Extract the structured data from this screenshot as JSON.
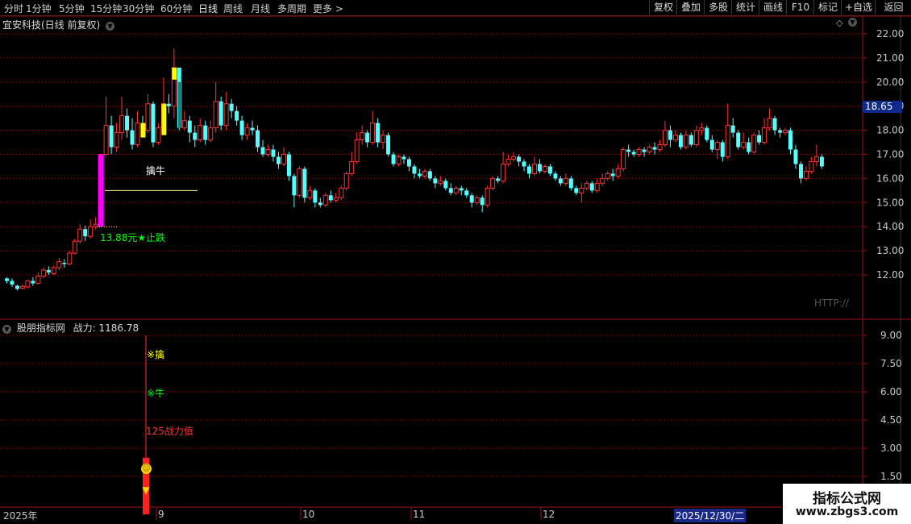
{
  "toolbar": {
    "periods": [
      "分时",
      "1分钟",
      "5分钟",
      "15分钟",
      "30分钟",
      "60分钟",
      "日线",
      "周线",
      "月线",
      "多周期",
      "更多 >"
    ],
    "active_period": "日线",
    "buttons": [
      "复权",
      "叠加",
      "多股",
      "统计",
      "画线",
      "F10",
      "标记",
      "+自选",
      "返回"
    ]
  },
  "main_chart": {
    "title": "宜安科技(日线 前复权)",
    "price_marker": "18.65",
    "watermark_text": "HTTP://",
    "annotations": {
      "niu": "擒牛",
      "stop": "13.88元★止跌"
    }
  },
  "indicator": {
    "title": "股朋指标网",
    "value_label": "战力: 1186.78",
    "labels": {
      "qin": "※擒",
      "niu": "※牛",
      "value": "125战力值"
    }
  },
  "dates": {
    "year": "2025年",
    "m9": "9",
    "m10": "10",
    "m11": "11",
    "m12": "12",
    "cursor": "2025/12/30/二"
  },
  "site_watermark": {
    "line1": "指标公式网",
    "line2": "www.zbgs3.com"
  },
  "colors": {
    "up": "#ff3232",
    "down": "#54ffff",
    "grid": "#a01010",
    "signal_magenta": "#ff00ff",
    "signal_yellow": "#ffff00",
    "signal_green": "#00ff00"
  },
  "chart_data": {
    "type": "candlestick",
    "y_axis": {
      "ticks": [
        "22.00",
        "21.00",
        "20.00",
        "19.00",
        "18.00",
        "17.00",
        "16.00",
        "15.00",
        "14.00",
        "13.00",
        "12.00"
      ],
      "range": [
        11.5,
        22.3
      ]
    },
    "indicator_axis": {
      "ticks": [
        "9.00",
        "7.50",
        "6.00",
        "4.50",
        "3.00",
        "1.50"
      ],
      "range": [
        0,
        10
      ]
    },
    "candles": [
      [
        11.85,
        11.75,
        11.9,
        11.65
      ],
      [
        11.75,
        11.6,
        11.85,
        11.5
      ],
      [
        11.55,
        11.42,
        11.6,
        11.35
      ],
      [
        11.45,
        11.52,
        11.6,
        11.4
      ],
      [
        11.5,
        11.75,
        11.8,
        11.45
      ],
      [
        11.75,
        11.65,
        11.9,
        11.55
      ],
      [
        11.65,
        11.95,
        12.1,
        11.6
      ],
      [
        11.95,
        12.2,
        12.3,
        11.85
      ],
      [
        12.2,
        12.1,
        12.35,
        12.0
      ],
      [
        12.05,
        12.3,
        12.4,
        12.0
      ],
      [
        12.3,
        12.55,
        12.7,
        12.2
      ],
      [
        12.5,
        12.45,
        12.65,
        12.3
      ],
      [
        12.45,
        12.9,
        13.0,
        12.4
      ],
      [
        12.9,
        13.4,
        13.5,
        12.85
      ],
      [
        13.4,
        13.9,
        14.1,
        13.3
      ],
      [
        13.9,
        13.6,
        14.05,
        13.4
      ],
      [
        13.6,
        14.0,
        14.3,
        13.5
      ],
      [
        14.0,
        14.1,
        14.4,
        13.88
      ],
      [
        14.1,
        17.0,
        17.0,
        14.0
      ],
      [
        17.0,
        18.2,
        19.4,
        16.9
      ],
      [
        18.2,
        17.3,
        18.6,
        17.0
      ],
      [
        17.3,
        17.9,
        18.3,
        17.1
      ],
      [
        17.9,
        18.6,
        19.4,
        17.6
      ],
      [
        18.6,
        18.0,
        18.9,
        17.7
      ],
      [
        18.0,
        17.4,
        18.5,
        17.2
      ],
      [
        17.4,
        18.3,
        18.8,
        17.3
      ],
      [
        18.3,
        18.0,
        18.6,
        17.8
      ],
      [
        18.0,
        19.1,
        19.5,
        17.9
      ],
      [
        19.1,
        17.5,
        19.2,
        17.3
      ],
      [
        17.5,
        18.1,
        18.3,
        17.4
      ],
      [
        18.1,
        19.1,
        20.2,
        17.9
      ],
      [
        19.1,
        19.0,
        19.5,
        18.7
      ],
      [
        19.0,
        20.6,
        21.4,
        18.5
      ],
      [
        20.6,
        18.1,
        20.6,
        18.0
      ],
      [
        18.1,
        18.4,
        18.8,
        18.0
      ],
      [
        18.4,
        17.9,
        18.6,
        17.5
      ],
      [
        17.9,
        17.6,
        18.2,
        17.3
      ],
      [
        17.6,
        18.2,
        18.5,
        17.5
      ],
      [
        18.2,
        17.6,
        18.4,
        17.4
      ],
      [
        17.6,
        18.1,
        18.4,
        17.5
      ],
      [
        18.1,
        19.2,
        20.0,
        17.9
      ],
      [
        19.2,
        18.2,
        19.4,
        18.0
      ],
      [
        18.2,
        19.1,
        19.6,
        18.0
      ],
      [
        19.1,
        18.8,
        19.3,
        18.5
      ],
      [
        18.8,
        18.4,
        19.0,
        18.2
      ],
      [
        18.4,
        17.8,
        18.6,
        17.6
      ],
      [
        17.8,
        18.1,
        18.3,
        17.6
      ],
      [
        18.1,
        18.0,
        18.4,
        17.8
      ],
      [
        18.0,
        17.3,
        18.2,
        17.1
      ],
      [
        17.3,
        17.0,
        17.6,
        16.9
      ],
      [
        17.0,
        17.2,
        17.4,
        16.9
      ],
      [
        17.2,
        16.9,
        17.4,
        16.7
      ],
      [
        16.9,
        16.6,
        17.1,
        16.4
      ],
      [
        16.6,
        17.0,
        17.3,
        16.5
      ],
      [
        17.0,
        16.1,
        17.1,
        15.9
      ],
      [
        16.1,
        15.3,
        16.2,
        14.8
      ],
      [
        15.3,
        16.4,
        16.5,
        15.2
      ],
      [
        16.4,
        15.2,
        16.5,
        15.0
      ],
      [
        15.2,
        15.5,
        15.7,
        15.1
      ],
      [
        15.5,
        15.0,
        15.6,
        14.8
      ],
      [
        15.0,
        14.9,
        15.2,
        14.8
      ],
      [
        14.9,
        15.3,
        15.4,
        14.8
      ],
      [
        15.3,
        15.1,
        15.5,
        15.0
      ],
      [
        15.1,
        15.2,
        15.4,
        15.0
      ],
      [
        15.2,
        15.6,
        15.7,
        15.1
      ],
      [
        15.6,
        16.2,
        16.3,
        15.5
      ],
      [
        16.2,
        16.7,
        17.1,
        16.1
      ],
      [
        16.7,
        17.6,
        17.9,
        16.6
      ],
      [
        17.6,
        17.9,
        18.2,
        17.4
      ],
      [
        17.9,
        17.5,
        18.0,
        17.3
      ],
      [
        17.5,
        18.3,
        18.8,
        17.4
      ],
      [
        18.3,
        17.5,
        18.5,
        17.3
      ],
      [
        17.5,
        17.8,
        18.0,
        17.2
      ],
      [
        17.8,
        17.0,
        17.9,
        16.9
      ],
      [
        17.0,
        16.6,
        17.1,
        16.5
      ],
      [
        16.6,
        16.9,
        17.0,
        16.5
      ],
      [
        16.9,
        16.8,
        17.0,
        16.6
      ],
      [
        16.8,
        16.5,
        16.9,
        16.3
      ],
      [
        16.5,
        16.2,
        16.6,
        16.0
      ],
      [
        16.2,
        16.1,
        16.4,
        16.0
      ],
      [
        16.1,
        16.3,
        16.4,
        16.0
      ],
      [
        16.3,
        16.0,
        16.4,
        15.9
      ],
      [
        16.0,
        15.8,
        16.1,
        15.6
      ],
      [
        15.8,
        15.9,
        16.1,
        15.7
      ],
      [
        15.9,
        15.6,
        16.0,
        15.5
      ],
      [
        15.6,
        15.4,
        15.8,
        15.3
      ],
      [
        15.4,
        15.6,
        15.7,
        15.3
      ],
      [
        15.6,
        15.5,
        15.7,
        15.3
      ],
      [
        15.5,
        15.3,
        15.6,
        15.2
      ],
      [
        15.3,
        15.0,
        15.4,
        14.8
      ],
      [
        15.0,
        15.2,
        15.3,
        14.9
      ],
      [
        15.2,
        14.9,
        15.3,
        14.6
      ],
      [
        14.9,
        15.6,
        15.7,
        14.8
      ],
      [
        15.6,
        16.0,
        16.1,
        15.5
      ],
      [
        16.0,
        15.9,
        16.1,
        15.8
      ],
      [
        15.9,
        16.6,
        17.1,
        15.8
      ],
      [
        16.6,
        16.8,
        17.0,
        16.5
      ],
      [
        16.8,
        16.9,
        17.1,
        16.7
      ],
      [
        16.9,
        16.7,
        17.0,
        16.5
      ],
      [
        16.7,
        16.5,
        16.8,
        16.3
      ],
      [
        16.5,
        16.2,
        16.6,
        16.0
      ],
      [
        16.2,
        16.6,
        16.9,
        16.1
      ],
      [
        16.6,
        16.3,
        16.8,
        16.2
      ],
      [
        16.3,
        16.5,
        16.6,
        16.2
      ],
      [
        16.5,
        16.2,
        16.6,
        16.1
      ],
      [
        16.2,
        16.0,
        16.3,
        15.9
      ],
      [
        16.0,
        15.8,
        16.1,
        15.7
      ],
      [
        15.8,
        16.0,
        16.2,
        15.7
      ],
      [
        16.0,
        15.6,
        16.1,
        15.5
      ],
      [
        15.6,
        15.4,
        15.7,
        15.3
      ],
      [
        15.4,
        15.6,
        15.8,
        15.0
      ],
      [
        15.6,
        15.8,
        15.9,
        15.5
      ],
      [
        15.8,
        15.5,
        15.9,
        15.4
      ],
      [
        15.5,
        15.8,
        16.0,
        15.4
      ],
      [
        15.8,
        16.0,
        16.2,
        15.7
      ],
      [
        16.0,
        16.2,
        16.3,
        15.9
      ],
      [
        16.2,
        16.1,
        16.4,
        15.9
      ],
      [
        16.1,
        16.4,
        16.6,
        16.0
      ],
      [
        16.4,
        17.2,
        17.3,
        16.3
      ],
      [
        17.2,
        17.1,
        17.4,
        16.9
      ],
      [
        17.1,
        17.0,
        17.2,
        16.9
      ],
      [
        17.0,
        17.2,
        17.3,
        16.9
      ],
      [
        17.2,
        17.1,
        17.3,
        16.9
      ],
      [
        17.1,
        17.3,
        17.4,
        17.0
      ],
      [
        17.3,
        17.2,
        17.5,
        17.0
      ],
      [
        17.2,
        17.4,
        17.6,
        17.1
      ],
      [
        17.4,
        18.0,
        18.4,
        17.3
      ],
      [
        18.0,
        17.6,
        18.2,
        17.3
      ],
      [
        17.6,
        17.8,
        18.0,
        17.5
      ],
      [
        17.8,
        17.3,
        17.9,
        17.2
      ],
      [
        17.3,
        17.8,
        18.0,
        17.2
      ],
      [
        17.8,
        17.4,
        17.9,
        17.3
      ],
      [
        17.4,
        18.0,
        18.2,
        17.3
      ],
      [
        18.0,
        18.1,
        18.3,
        17.8
      ],
      [
        18.1,
        17.6,
        18.2,
        17.5
      ],
      [
        17.6,
        17.2,
        17.8,
        17.1
      ],
      [
        17.2,
        17.5,
        17.6,
        16.8
      ],
      [
        17.5,
        16.9,
        17.6,
        16.7
      ],
      [
        16.9,
        18.2,
        19.1,
        16.8
      ],
      [
        18.2,
        17.9,
        18.5,
        17.7
      ],
      [
        17.9,
        17.3,
        18.0,
        17.2
      ],
      [
        17.3,
        17.5,
        17.9,
        17.2
      ],
      [
        17.5,
        17.1,
        17.7,
        17.0
      ],
      [
        17.1,
        17.8,
        17.9,
        17.0
      ],
      [
        17.8,
        17.5,
        18.0,
        17.4
      ],
      [
        17.5,
        18.1,
        18.5,
        17.4
      ],
      [
        18.1,
        18.5,
        18.9,
        18.0
      ],
      [
        18.5,
        18.0,
        18.6,
        17.8
      ],
      [
        18.0,
        17.9,
        18.1,
        17.7
      ],
      [
        17.9,
        18.0,
        18.1,
        17.8
      ],
      [
        18.0,
        17.2,
        18.1,
        17.0
      ],
      [
        17.2,
        16.6,
        17.4,
        16.4
      ],
      [
        16.6,
        16.0,
        16.7,
        15.8
      ],
      [
        16.0,
        16.3,
        16.5,
        15.9
      ],
      [
        16.3,
        16.7,
        16.9,
        16.2
      ],
      [
        16.7,
        16.9,
        17.4,
        16.5
      ],
      [
        16.9,
        16.5,
        17.0,
        16.4
      ]
    ]
  }
}
